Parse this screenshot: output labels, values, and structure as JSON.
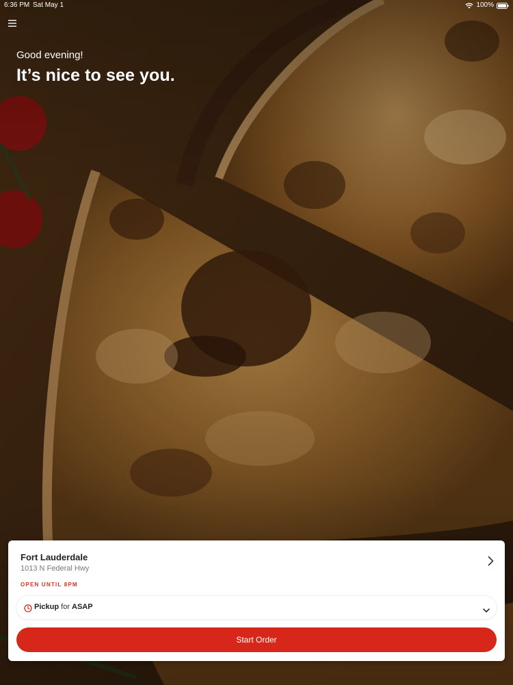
{
  "status_bar": {
    "time": "6:36 PM",
    "date": "Sat May 1",
    "battery": "100%"
  },
  "header": {
    "menu_icon": "hamburger-menu-icon",
    "greeting": "Good evening!",
    "headline": "It’s nice to see you."
  },
  "order_card": {
    "location": {
      "name": "Fort Lauderdale",
      "address": "1013 N Federal Hwy",
      "hours": "OPEN UNTIL 8PM",
      "chevron_icon": "chevron-right-icon"
    },
    "pickup": {
      "clock_icon": "clock-icon",
      "mode": "Pickup",
      "connector": " for ",
      "time": "ASAP",
      "chevron_icon": "chevron-down-icon"
    },
    "start_order_label": "Start Order"
  },
  "colors": {
    "accent": "#d7261a",
    "hours_text": "#d7321c",
    "card_background": "#ffffff"
  }
}
